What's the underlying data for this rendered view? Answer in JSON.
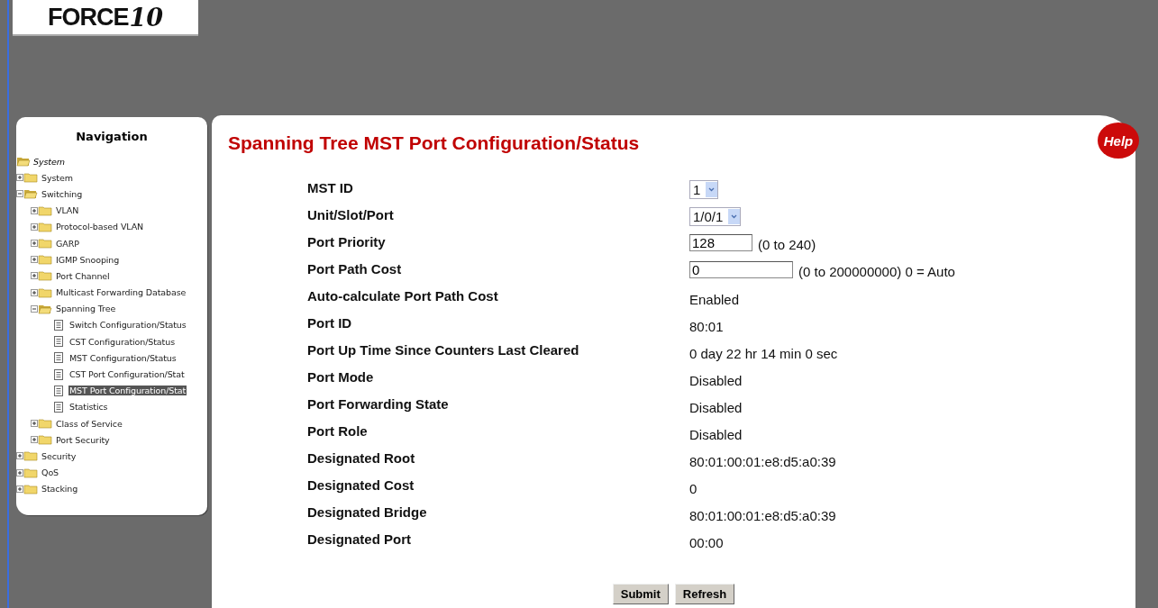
{
  "logo": {
    "text": "FORCE",
    "mark": "10"
  },
  "navigation": {
    "title": "Navigation",
    "root": "System",
    "items": [
      {
        "label": "System",
        "kind": "folder",
        "expanded": false,
        "selected": false
      },
      {
        "label": "Switching",
        "kind": "folder",
        "expanded": true,
        "selected": false,
        "children": [
          {
            "label": "VLAN",
            "kind": "folder",
            "expanded": false,
            "selected": false
          },
          {
            "label": "Protocol-based VLAN",
            "kind": "folder",
            "expanded": false,
            "selected": false
          },
          {
            "label": "GARP",
            "kind": "folder",
            "expanded": false,
            "selected": false
          },
          {
            "label": "IGMP Snooping",
            "kind": "folder",
            "expanded": false,
            "selected": false
          },
          {
            "label": "Port Channel",
            "kind": "folder",
            "expanded": false,
            "selected": false
          },
          {
            "label": "Multicast Forwarding Database",
            "kind": "folder",
            "expanded": false,
            "selected": false
          },
          {
            "label": "Spanning Tree",
            "kind": "folder",
            "expanded": true,
            "selected": false,
            "children": [
              {
                "label": "Switch Configuration/Status",
                "kind": "page",
                "selected": false
              },
              {
                "label": "CST Configuration/Status",
                "kind": "page",
                "selected": false
              },
              {
                "label": "MST Configuration/Status",
                "kind": "page",
                "selected": false
              },
              {
                "label": "CST Port Configuration/Stat",
                "kind": "page",
                "selected": false
              },
              {
                "label": "MST Port Configuration/Stat",
                "kind": "page",
                "selected": true
              },
              {
                "label": "Statistics",
                "kind": "page",
                "selected": false
              }
            ]
          },
          {
            "label": "Class of Service",
            "kind": "folder",
            "expanded": false,
            "selected": false
          },
          {
            "label": "Port Security",
            "kind": "folder",
            "expanded": false,
            "selected": false
          }
        ]
      },
      {
        "label": "Security",
        "kind": "folder",
        "expanded": false,
        "selected": false
      },
      {
        "label": "QoS",
        "kind": "folder",
        "expanded": false,
        "selected": false
      },
      {
        "label": "Stacking",
        "kind": "folder",
        "expanded": false,
        "selected": false
      }
    ]
  },
  "page": {
    "title": "Spanning Tree MST Port Configuration/Status",
    "help": "Help",
    "fields": [
      {
        "label": "MST ID",
        "kind": "select",
        "value": "1"
      },
      {
        "label": "Unit/Slot/Port",
        "kind": "select",
        "value": "1/0/1"
      },
      {
        "label": "Port Priority",
        "kind": "input",
        "value": "128",
        "hint": "(0 to 240)"
      },
      {
        "label": "Port Path Cost",
        "kind": "input",
        "value": "0",
        "hint": "(0 to 200000000) 0 = Auto"
      },
      {
        "label": "Auto-calculate Port Path Cost",
        "kind": "text",
        "value": "Enabled"
      },
      {
        "label": "Port ID",
        "kind": "text",
        "value": "80:01"
      },
      {
        "label": "Port Up Time Since Counters Last Cleared",
        "kind": "text",
        "value": "0 day 22 hr 14 min 0 sec"
      },
      {
        "label": "Port Mode",
        "kind": "text",
        "value": "Disabled"
      },
      {
        "label": "Port Forwarding State",
        "kind": "text",
        "value": "Disabled"
      },
      {
        "label": "Port Role",
        "kind": "text",
        "value": "Disabled"
      },
      {
        "label": "Designated Root",
        "kind": "text",
        "value": "80:01:00:01:e8:d5:a0:39"
      },
      {
        "label": "Designated Cost",
        "kind": "text",
        "value": "0"
      },
      {
        "label": "Designated Bridge",
        "kind": "text",
        "value": "80:01:00:01:e8:d5:a0:39"
      },
      {
        "label": "Designated Port",
        "kind": "text",
        "value": "00:00"
      }
    ],
    "buttons": [
      "Submit",
      "Refresh"
    ]
  }
}
